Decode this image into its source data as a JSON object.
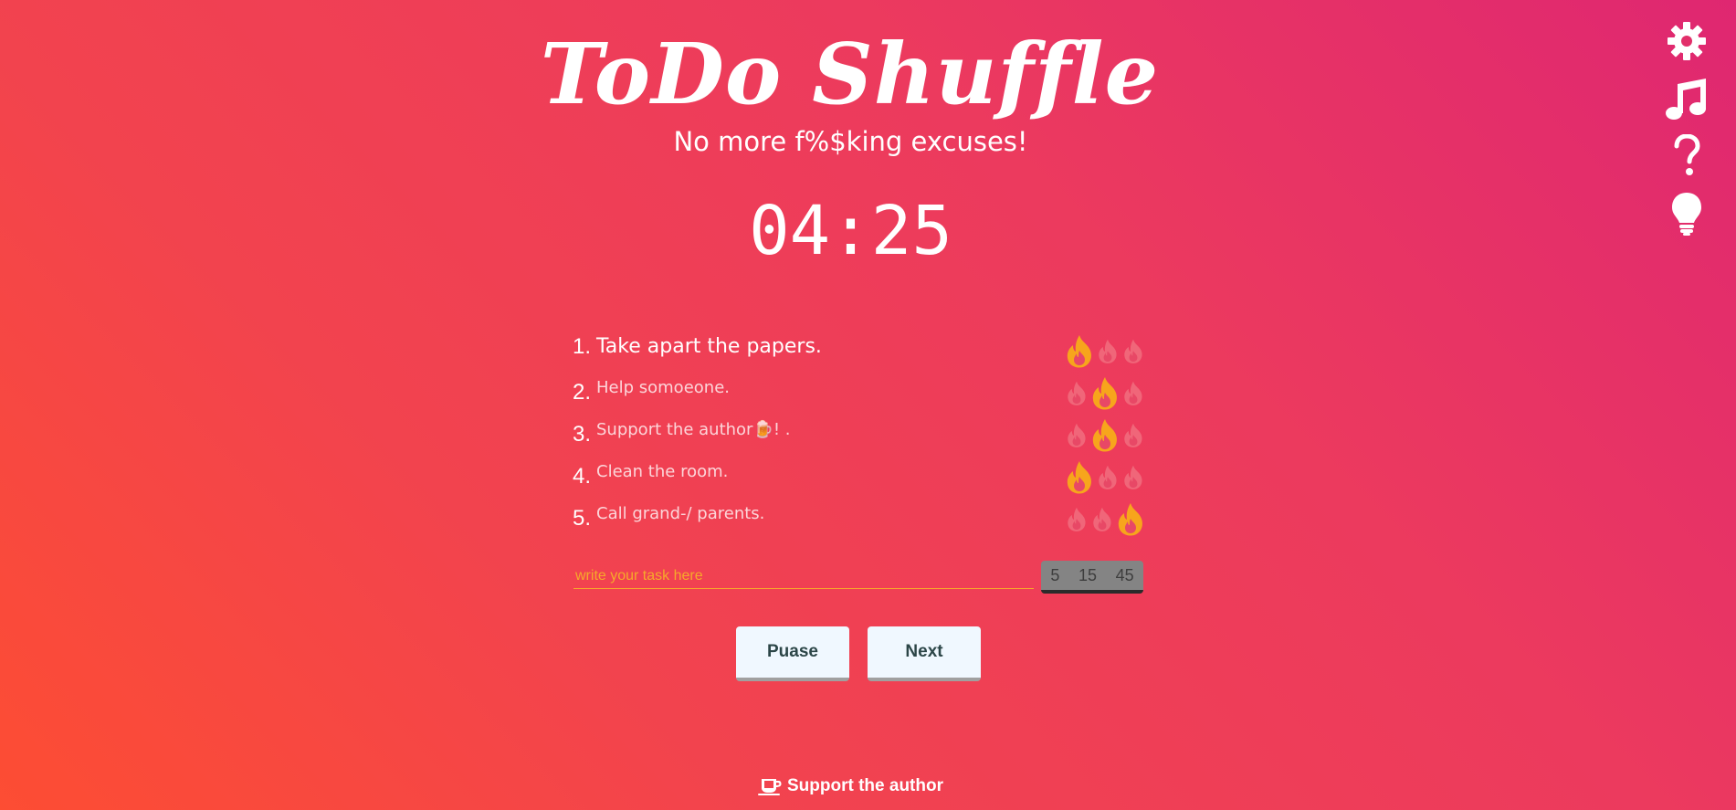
{
  "app": {
    "title": "ToDo Shuffle",
    "subtitle": "No more f%$king excuses!"
  },
  "timer": {
    "display": "04:25"
  },
  "side_menu": [
    {
      "icon": "gear-icon",
      "name": "settings"
    },
    {
      "icon": "music-icon",
      "name": "music"
    },
    {
      "icon": "question-icon",
      "name": "help"
    },
    {
      "icon": "lightbulb-icon",
      "name": "ideas"
    }
  ],
  "tasks": [
    {
      "number": "1.",
      "text": "Take apart the papers.",
      "difficulty": 1,
      "current": true
    },
    {
      "number": "2.",
      "text": "Help somoeone.",
      "difficulty": 2,
      "current": false
    },
    {
      "number": "3.",
      "text": "Support the author🍺! .",
      "difficulty": 2,
      "current": false
    },
    {
      "number": "4.",
      "text": "Clean the room.",
      "difficulty": 1,
      "current": false
    },
    {
      "number": "5.",
      "text": "Call grand-/ parents.",
      "difficulty": 3,
      "current": false
    }
  ],
  "new_task": {
    "placeholder": "write your task here",
    "value": ""
  },
  "duration_options": [
    "5",
    "15",
    "45"
  ],
  "buttons": {
    "pause_label": "Puase",
    "next_label": "Next"
  },
  "footer": {
    "support_label": "Support the author"
  },
  "colors": {
    "flame_active": "#f7a51c",
    "flame_inactive": "#f06679",
    "input_accent": "#f6a92a",
    "button_bg": "#f0f8ff",
    "button_text": "#2c4648"
  }
}
